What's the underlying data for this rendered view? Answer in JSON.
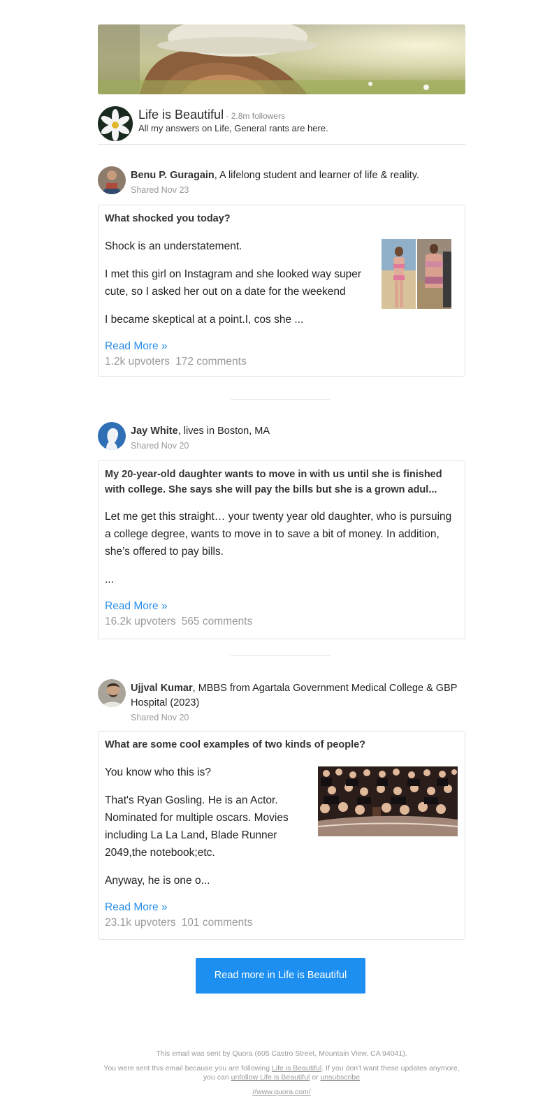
{
  "space": {
    "title": "Life is Beautiful",
    "followers": " · 2.8m followers",
    "description": "All my answers on Life, General rants are here."
  },
  "posts": [
    {
      "author": "Benu P. Guragain",
      "credential": ", A lifelong student and learner of life & reality.",
      "shared": "Shared Nov 23",
      "question": "What shocked you today?",
      "paragraphs": [
        "Shock is an understatement.",
        "I met this girl on Instagram and she looked way super cute, so I asked her out on a date for the weekend",
        "I became skeptical at a point.I, cos she ..."
      ],
      "read_more": "Read More »",
      "upvoters": "1.2k upvoters",
      "comments": "172 comments"
    },
    {
      "author": "Jay White",
      "credential": ", lives in Boston, MA",
      "shared": "Shared Nov 20",
      "question": "My 20-year-old daughter wants to move in with us until she is finished with college. She says she will pay the bills but she is a grown adul...",
      "paragraphs": [
        "Let me get this straight… your twenty year old daughter, who is pursuing a college degree, wants to move in to save a bit of money. In addition, she’s offered to pay bills.",
        "..."
      ],
      "read_more": "Read More »",
      "upvoters": "16.2k upvoters",
      "comments": "565 comments"
    },
    {
      "author": "Ujjval Kumar",
      "credential": ", MBBS from Agartala Government Medical College & GBP Hospital (2023)",
      "shared": "Shared Nov 20",
      "question": "What are some cool examples of two kinds of people?",
      "paragraphs": [
        "You know who this is?",
        "That's Ryan Gosling. He is an Actor. Nominated for multiple oscars. Movies including La La Land, Blade Runner 2049,the notebook;etc.",
        "Anyway, he is one o..."
      ],
      "read_more": "Read More »",
      "upvoters": "23.1k upvoters",
      "comments": "101 comments"
    }
  ],
  "cta": {
    "label": "Read more in Life is Beautiful"
  },
  "footer": {
    "line1": "This email was sent by Quora (605 Castro Street, Mountain View, CA 94041).",
    "line2a": "You were sent this email because you are following ",
    "link_following": "Life is Beautiful",
    "line2b": ". If you don't want these updates anymore, you can ",
    "link_unfollow": "unfollow Life is Beautiful",
    "line2c": " or ",
    "link_unsubscribe": "unsubscribe",
    "link_home": "//www.quora.com/"
  },
  "colors": {
    "accent": "#1d8ff0",
    "link": "#2b8ee6",
    "muted": "#9a9a9a"
  }
}
